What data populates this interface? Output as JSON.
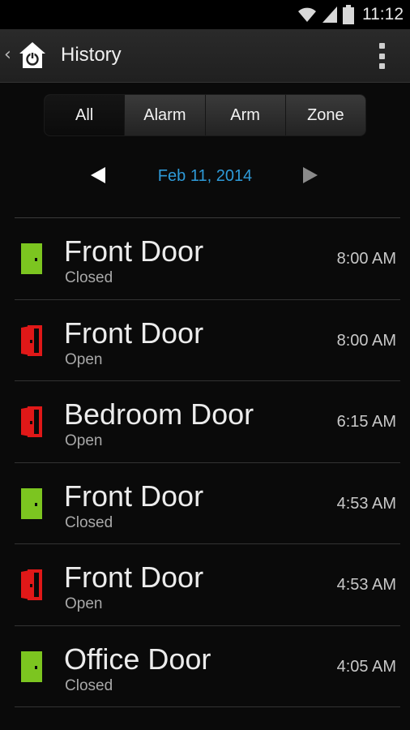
{
  "status_bar": {
    "time": "11:12"
  },
  "action_bar": {
    "title": "History"
  },
  "tabs": [
    {
      "label": "All",
      "active": true
    },
    {
      "label": "Alarm",
      "active": false
    },
    {
      "label": "Arm",
      "active": false
    },
    {
      "label": "Zone",
      "active": false
    }
  ],
  "date_nav": {
    "date": "Feb 11, 2014"
  },
  "events": [
    {
      "name": "Front Door",
      "state": "Closed",
      "time": "8:00 AM",
      "icon": "door-closed-icon",
      "color": "#7cc520"
    },
    {
      "name": "Front Door",
      "state": "Open",
      "time": "8:00 AM",
      "icon": "door-open-icon",
      "color": "#e01818"
    },
    {
      "name": "Bedroom Door",
      "state": "Open",
      "time": "6:15 AM",
      "icon": "door-open-icon",
      "color": "#e01818"
    },
    {
      "name": "Front Door",
      "state": "Closed",
      "time": "4:53 AM",
      "icon": "door-closed-icon",
      "color": "#7cc520"
    },
    {
      "name": "Front Door",
      "state": "Open",
      "time": "4:53 AM",
      "icon": "door-open-icon",
      "color": "#e01818"
    },
    {
      "name": "Office Door",
      "state": "Closed",
      "time": "4:05 AM",
      "icon": "door-closed-icon",
      "color": "#7cc520"
    }
  ],
  "colors": {
    "accent": "#2e9ad8",
    "closed": "#7cc520",
    "open": "#e01818"
  }
}
